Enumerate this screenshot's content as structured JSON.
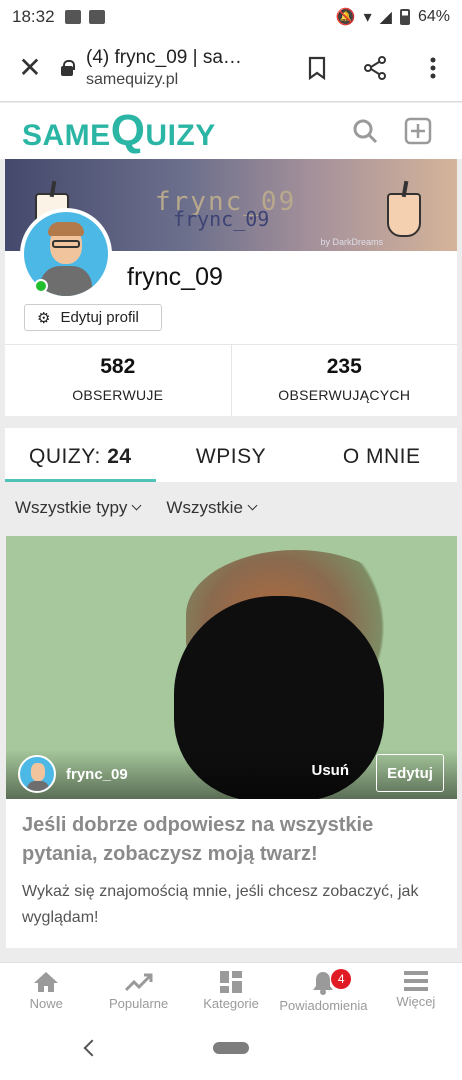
{
  "status": {
    "time": "18:32",
    "battery": "64%"
  },
  "browser": {
    "tab_title": "(4) frync_09 | sa…",
    "host": "samequizy.pl"
  },
  "site": {
    "logo_part1": "SAME",
    "logo_q": "Q",
    "logo_part2": "UIZY"
  },
  "profile": {
    "banner_text": "frync_09",
    "banner_text2": "frync_09",
    "banner_credit": "by DarkDreams",
    "username": "frync_09",
    "edit_label": "Edytuj profil",
    "online": true
  },
  "stats": [
    {
      "num": "582",
      "label": "OBSERWUJE"
    },
    {
      "num": "235",
      "label": "OBSERWUJĄCYCH"
    }
  ],
  "tabs": {
    "quizzes_label": "QUIZY:",
    "quizzes_count": "24",
    "posts": "WPISY",
    "about": "O MNIE"
  },
  "filters": {
    "type": "Wszystkie typy",
    "all": "Wszystkie"
  },
  "quiz": {
    "author": "frync_09",
    "delete": "Usuń",
    "edit": "Edytuj",
    "title": "Jeśli dobrze odpowiesz na wszystkie pytania, zobaczysz moją twarz!",
    "description": "Wykaż się znajomością mnie, jeśli chcesz zobaczyć, jak wyglądam!"
  },
  "nav": {
    "home": "Nowe",
    "popular": "Popularne",
    "categories": "Kategorie",
    "notifications": "Powiadomienia",
    "notifications_badge": "4",
    "more": "Więcej"
  },
  "colors": {
    "accent": "#2bb5a4",
    "tab_underline": "#4fc3b7",
    "badge": "#e01b24",
    "online": "#22c02e"
  }
}
